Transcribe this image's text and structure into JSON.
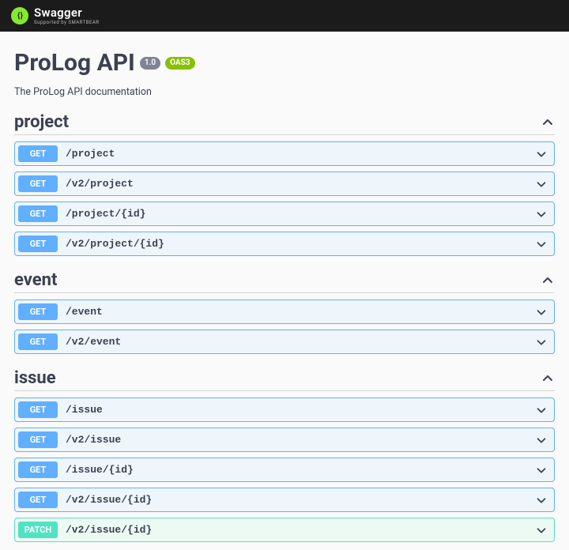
{
  "brand": {
    "name": "Swagger",
    "supported_by": "Supported by SMARTBEAR"
  },
  "api": {
    "title": "ProLog API",
    "version": "1.0",
    "oas": "OAS3",
    "description": "The ProLog API documentation"
  },
  "sections": [
    {
      "name": "project",
      "ops": [
        {
          "method": "GET",
          "method_class": "get",
          "path": "/project"
        },
        {
          "method": "GET",
          "method_class": "get",
          "path": "/v2/project"
        },
        {
          "method": "GET",
          "method_class": "get",
          "path": "/project/{id}"
        },
        {
          "method": "GET",
          "method_class": "get",
          "path": "/v2/project/{id}"
        }
      ]
    },
    {
      "name": "event",
      "ops": [
        {
          "method": "GET",
          "method_class": "get",
          "path": "/event"
        },
        {
          "method": "GET",
          "method_class": "get",
          "path": "/v2/event"
        }
      ]
    },
    {
      "name": "issue",
      "ops": [
        {
          "method": "GET",
          "method_class": "get",
          "path": "/issue"
        },
        {
          "method": "GET",
          "method_class": "get",
          "path": "/v2/issue"
        },
        {
          "method": "GET",
          "method_class": "get",
          "path": "/issue/{id}"
        },
        {
          "method": "GET",
          "method_class": "get",
          "path": "/v2/issue/{id}"
        },
        {
          "method": "PATCH",
          "method_class": "patch",
          "path": "/v2/issue/{id}"
        }
      ]
    }
  ]
}
